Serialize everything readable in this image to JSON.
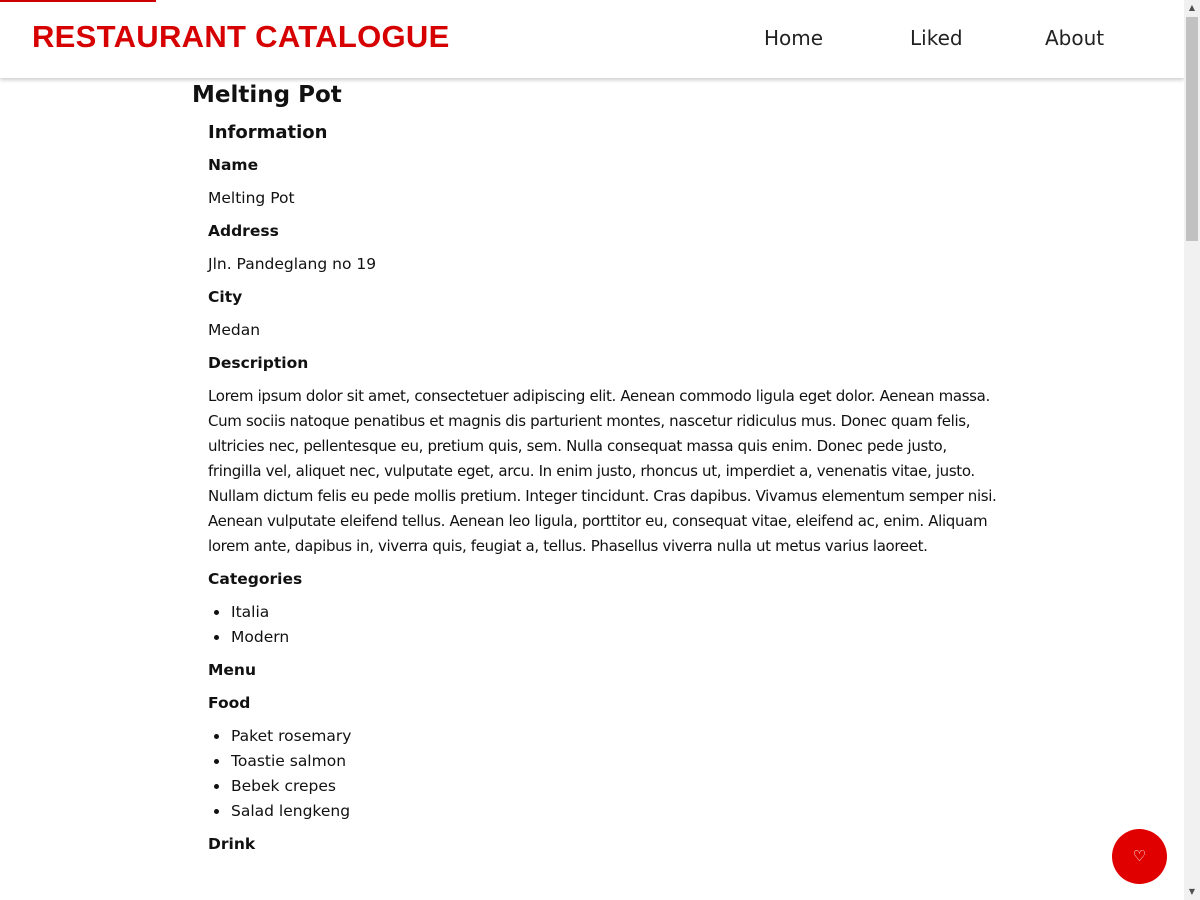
{
  "header": {
    "brand": "RESTAURANT CATALOGUE",
    "nav": {
      "home": "Home",
      "liked": "Liked",
      "about": "About"
    }
  },
  "restaurant": {
    "title": "Melting Pot",
    "section_title": "Information",
    "name_label": "Name",
    "name": "Melting Pot",
    "address_label": "Address",
    "address": "Jln. Pandeglang no 19",
    "city_label": "City",
    "city": "Medan",
    "description_label": "Description",
    "description": "Lorem ipsum dolor sit amet, consectetuer adipiscing elit. Aenean commodo ligula eget dolor. Aenean massa. Cum sociis natoque penatibus et magnis dis parturient montes, nascetur ridiculus mus. Donec quam felis, ultricies nec, pellentesque eu, pretium quis, sem. Nulla consequat massa quis enim. Donec pede justo, fringilla vel, aliquet nec, vulputate eget, arcu. In enim justo, rhoncus ut, imperdiet a, venenatis vitae, justo. Nullam dictum felis eu pede mollis pretium. Integer tincidunt. Cras dapibus. Vivamus elementum semper nisi. Aenean vulputate eleifend tellus. Aenean leo ligula, porttitor eu, consequat vitae, eleifend ac, enim. Aliquam lorem ante, dapibus in, viverra quis, feugiat a, tellus. Phasellus viverra nulla ut metus varius laoreet.",
    "categories_label": "Categories",
    "categories": [
      "Italia",
      "Modern"
    ],
    "menu_label": "Menu",
    "food_label": "Food",
    "foods": [
      "Paket rosemary",
      "Toastie salmon",
      "Bebek crepes",
      "Salad lengkeng"
    ],
    "drink_label": "Drink"
  },
  "like_button": {
    "icon": "heart-icon"
  },
  "colors": {
    "brand": "#d60000",
    "like_button": "#e00000"
  }
}
